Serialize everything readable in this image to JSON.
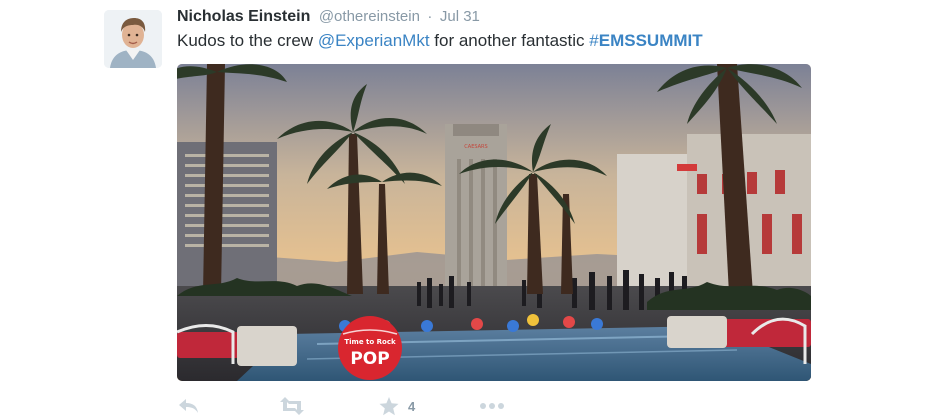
{
  "tweet": {
    "author_name": "Nicholas Einstein",
    "handle": "@othereinstein",
    "separator": "·",
    "date": "Jul 31",
    "text_prefix": "Kudos to the crew ",
    "mention": "@ExperianMkt",
    "text_middle": " for another fantastic ",
    "hashtag_symbol": "#",
    "hashtag": "EMSSUMMIT",
    "photo_sign_text": "CAESARS",
    "ball_text_top": "Time to Rock",
    "ball_text_bottom": "POP"
  },
  "actions": {
    "reply_icon": "reply-icon",
    "retweet_icon": "retweet-icon",
    "favorite_icon": "star-icon",
    "favorite_count": "4",
    "more_icon": "more-icon"
  },
  "colors": {
    "link": "#3b84c4",
    "name": "#292f33",
    "meta": "#8899a6",
    "action_icon": "#ccd6dd"
  }
}
